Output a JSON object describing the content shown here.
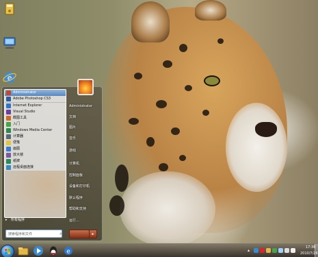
{
  "desktop": {
    "icons": [
      {
        "label": "",
        "icon": "computer-icon"
      },
      {
        "label": "",
        "icon": "network-icon"
      },
      {
        "label": "",
        "icon": "internet-explorer-icon"
      }
    ]
  },
  "start_menu": {
    "programs": [
      {
        "label": "Administrator",
        "color": "#c24a2c"
      },
      {
        "label": "Adobe Photoshop CS3",
        "color": "#2d5fa0"
      },
      {
        "label": "Internet Explorer",
        "color": "#2f77c6"
      },
      {
        "label": "Visual Studio",
        "color": "#6a3fa0"
      },
      {
        "label": "截图工具",
        "color": "#d06a2a"
      },
      {
        "label": "入门",
        "color": "#4aa34a"
      },
      {
        "label": "Windows Media Center",
        "color": "#2c8a4a"
      },
      {
        "label": "计算器",
        "color": "#5a6a7a"
      },
      {
        "label": "便笺",
        "color": "#e3c43a"
      },
      {
        "label": "画图",
        "color": "#3a7ad0"
      },
      {
        "label": "放大镜",
        "color": "#7a5aa0"
      },
      {
        "label": "纸牌",
        "color": "#2a8a5a"
      },
      {
        "label": "远程桌面连接",
        "color": "#3a8ac0"
      }
    ],
    "highlighted_index": 0,
    "all_programs_label": "所有程序",
    "search_placeholder": "搜索程序和文件",
    "right_links": [
      "Administrator",
      "文档",
      "图片",
      "音乐",
      "游戏",
      "计算机",
      "控制面板",
      "设备和打印机",
      "默认程序",
      "帮助和支持",
      "运行..."
    ],
    "shutdown_label": ""
  },
  "taskbar": {
    "apps": [
      {
        "icon": "explorer-icon",
        "color": "#e3b84a"
      },
      {
        "icon": "media-player-icon",
        "color": "#3a8ad0"
      },
      {
        "icon": "qq-icon",
        "color": "#222222"
      },
      {
        "icon": "internet-explorer-icon",
        "color": "#2f77c6"
      }
    ],
    "time": "17:36",
    "date": "2010/7/26"
  }
}
